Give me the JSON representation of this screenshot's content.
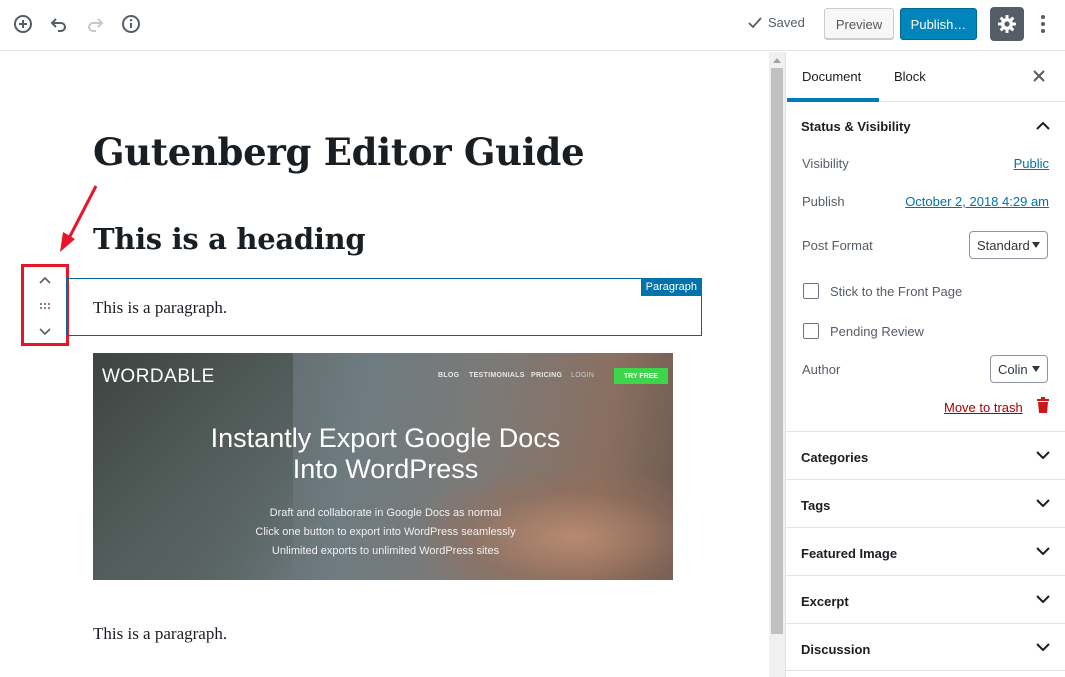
{
  "toolbar": {
    "saved_label": "Saved",
    "preview_label": "Preview",
    "publish_label": "Publish…"
  },
  "editor": {
    "title": "Gutenberg Editor Guide",
    "heading": "This is a heading",
    "paragraph_1": "This is a paragraph.",
    "block_label": "Paragraph",
    "paragraph_2": "This is a paragraph.",
    "image": {
      "logo": "WORDABLE",
      "nav": [
        "BLOG",
        "TESTIMONIALS",
        "PRICING",
        "LOGIN"
      ],
      "cta": "TRY FREE",
      "headline_1": "Instantly Export Google Docs",
      "headline_2": "Into WordPress",
      "sub_1": "Draft and collaborate in Google Docs as normal",
      "sub_2": "Click one button to export into WordPress seamlessly",
      "sub_3": "Unlimited exports to unlimited WordPress sites"
    }
  },
  "sidebar": {
    "tabs": [
      "Document",
      "Block"
    ],
    "active_tab": "Document",
    "status_title": "Status & Visibility",
    "visibility_label": "Visibility",
    "visibility_value": "Public",
    "publish_label": "Publish",
    "publish_value": "October 2, 2018 4:29 am",
    "post_format_label": "Post Format",
    "post_format_value": "Standard",
    "sticky_label": "Stick to the Front Page",
    "pending_label": "Pending Review",
    "author_label": "Author",
    "author_value": "Colin",
    "trash_label": "Move to trash",
    "panels": [
      "Categories",
      "Tags",
      "Featured Image",
      "Excerpt",
      "Discussion"
    ]
  },
  "colors": {
    "accent": "#0085ba",
    "highlight_red": "#e8152a",
    "trash": "#a00000"
  }
}
